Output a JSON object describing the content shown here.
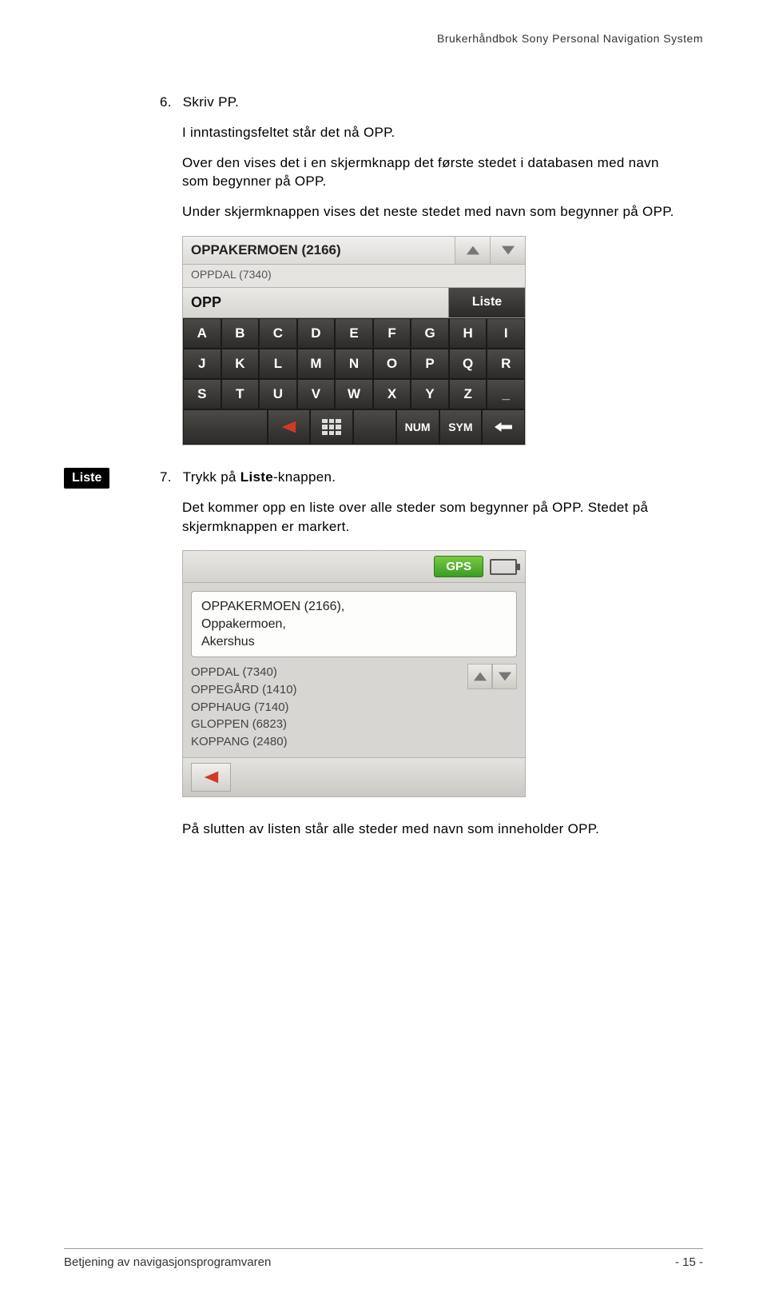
{
  "header": {
    "title": "Brukerhåndbok Sony Personal Navigation System"
  },
  "step6": {
    "num": "6.",
    "line1": "Skriv PP.",
    "line2": "I inntastingsfeltet står det nå OPP.",
    "line3": "Over den vises det i en skjermknapp det første stedet i databasen med navn som begynner på OPP.",
    "line4": "Under skjermknappen vises det neste stedet med navn som begynner på OPP."
  },
  "kb": {
    "suggest_main": "OPPAKERMOEN (2166)",
    "suggest_sub": "OPPDAL (7340)",
    "input_value": "OPP",
    "liste_label": "Liste",
    "rows": [
      [
        "A",
        "B",
        "C",
        "D",
        "E",
        "F",
        "G",
        "H",
        "I"
      ],
      [
        "J",
        "K",
        "L",
        "M",
        "N",
        "O",
        "P",
        "Q",
        "R"
      ],
      [
        "S",
        "T",
        "U",
        "V",
        "W",
        "X",
        "Y",
        "Z",
        "_"
      ]
    ],
    "bottom": {
      "num": "NUM",
      "sym": "SYM"
    }
  },
  "sidebadge": {
    "label": "Liste"
  },
  "step7": {
    "num": "7.",
    "line1_pre": "Trykk på ",
    "line1_bold": "Liste",
    "line1_post": "-knappen.",
    "line2": "Det kommer opp en liste over alle steder som begynner på OPP. Stedet på skjermknappen er markert."
  },
  "results": {
    "gps": "GPS",
    "selected": [
      "OPPAKERMOEN (2166),",
      "Oppakermoen,",
      "Akershus"
    ],
    "others": [
      "OPPDAL (7340)",
      "OPPEGÅRD (1410)",
      "OPPHAUG (7140)",
      "GLOPPEN (6823)",
      "KOPPANG (2480)"
    ]
  },
  "after_results": "På slutten av listen står alle steder med navn som inneholder OPP.",
  "footer": {
    "left": "Betjening av navigasjonsprogramvaren",
    "right": "- 15 -"
  }
}
